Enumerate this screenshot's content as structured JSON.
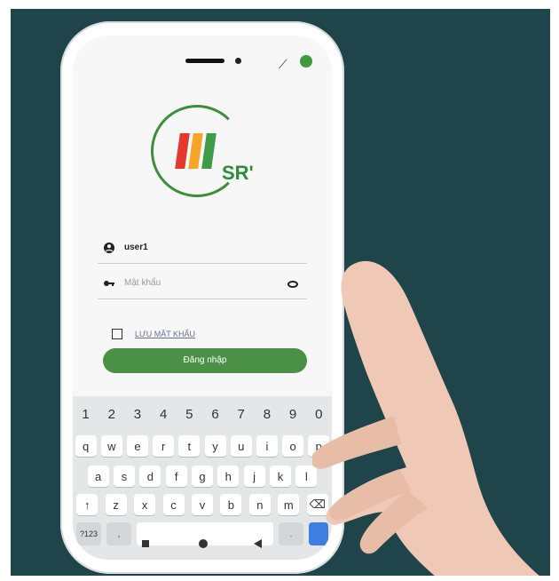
{
  "login": {
    "username_value": "user1",
    "password_placeholder": "Mật khẩu",
    "remember_label": "LƯU MẬT KHẨU",
    "login_button": "Đăng nhập"
  },
  "logo": {
    "text": "SR'",
    "bar_colors": [
      "#e23a2e",
      "#f6a529",
      "#3f9b45"
    ],
    "ring_color": "#3b8f3b"
  },
  "keyboard": {
    "numbers": [
      "1",
      "2",
      "3",
      "4",
      "5",
      "6",
      "7",
      "8",
      "9",
      "0"
    ],
    "row1": [
      "q",
      "w",
      "e",
      "r",
      "t",
      "y",
      "u",
      "i",
      "o",
      "p"
    ],
    "row2": [
      "a",
      "s",
      "d",
      "f",
      "g",
      "h",
      "j",
      "k",
      "l"
    ],
    "row3": [
      "↑",
      "z",
      "x",
      "c",
      "v",
      "b",
      "n",
      "m",
      "⌫"
    ],
    "bottom": {
      "symbols": "?123",
      "comma": ",",
      "period": "."
    }
  },
  "colors": {
    "background": "#1f4449",
    "accent": "#4a9147"
  }
}
